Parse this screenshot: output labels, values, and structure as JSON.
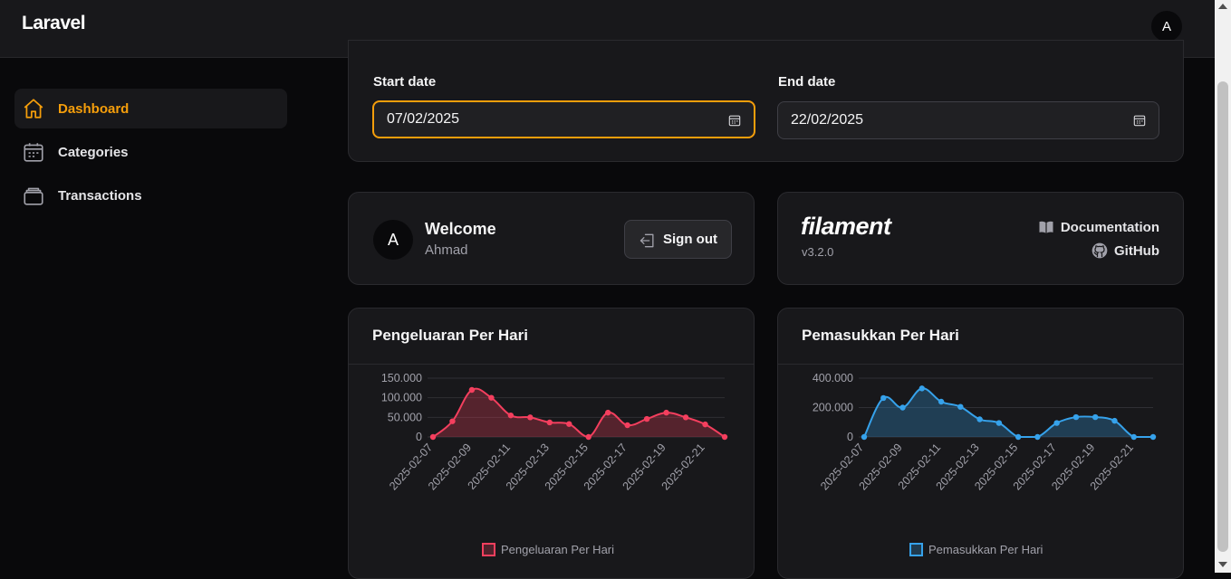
{
  "topbar": {
    "brand": "Laravel",
    "avatar_initial": "A"
  },
  "sidebar": {
    "items": [
      {
        "label": "Dashboard",
        "icon": "home-icon",
        "active": true
      },
      {
        "label": "Categories",
        "icon": "calendar-icon",
        "active": false
      },
      {
        "label": "Transactions",
        "icon": "wallet-icon",
        "active": false
      }
    ]
  },
  "filters": {
    "start_label": "Start date",
    "start_value": "07/02/2025",
    "end_label": "End date",
    "end_value": "22/02/2025"
  },
  "welcome": {
    "avatar_initial": "A",
    "title": "Welcome",
    "name": "Ahmad",
    "signout_label": "Sign out"
  },
  "filament": {
    "logo": "filament",
    "version": "v3.2.0",
    "docs_label": "Documentation",
    "github_label": "GitHub"
  },
  "colors": {
    "accent": "#f59e0b",
    "expense": "#f43f5e",
    "income": "#36a2eb"
  },
  "chart_data": [
    {
      "type": "area",
      "title": "Pengeluaran Per Hari",
      "x": [
        "2025-02-07",
        "2025-02-08",
        "2025-02-09",
        "2025-02-10",
        "2025-02-11",
        "2025-02-12",
        "2025-02-13",
        "2025-02-14",
        "2025-02-15",
        "2025-02-16",
        "2025-02-17",
        "2025-02-18",
        "2025-02-19",
        "2025-02-20",
        "2025-02-21",
        "2025-02-22"
      ],
      "tick_labels": [
        "2025-02-07",
        "2025-02-09",
        "2025-02-11",
        "2025-02-13",
        "2025-02-15",
        "2025-02-17",
        "2025-02-19",
        "2025-02-21"
      ],
      "series": [
        {
          "name": "Pengeluaran Per Hari",
          "values": [
            0,
            40000,
            120000,
            100000,
            55000,
            50000,
            37000,
            33000,
            0,
            62000,
            30000,
            46000,
            62000,
            50000,
            32000,
            0
          ]
        }
      ],
      "yticks": [
        "0",
        "50.000",
        "100.000",
        "150.000"
      ],
      "ylim": [
        0,
        150000
      ],
      "grid": true,
      "legend": "bottom"
    },
    {
      "type": "area",
      "title": "Pemasukkan Per Hari",
      "x": [
        "2025-02-07",
        "2025-02-08",
        "2025-02-09",
        "2025-02-10",
        "2025-02-11",
        "2025-02-12",
        "2025-02-13",
        "2025-02-14",
        "2025-02-15",
        "2025-02-16",
        "2025-02-17",
        "2025-02-18",
        "2025-02-19",
        "2025-02-20",
        "2025-02-21",
        "2025-02-22"
      ],
      "tick_labels": [
        "2025-02-07",
        "2025-02-09",
        "2025-02-11",
        "2025-02-13",
        "2025-02-15",
        "2025-02-17",
        "2025-02-19",
        "2025-02-21"
      ],
      "series": [
        {
          "name": "Pemasukkan Per Hari",
          "values": [
            0,
            265000,
            200000,
            330000,
            240000,
            205000,
            120000,
            95000,
            0,
            0,
            95000,
            135000,
            135000,
            110000,
            0,
            0
          ]
        }
      ],
      "yticks": [
        "0",
        "200.000",
        "400.000"
      ],
      "ylim": [
        0,
        400000
      ],
      "grid": true,
      "legend": "bottom"
    }
  ]
}
